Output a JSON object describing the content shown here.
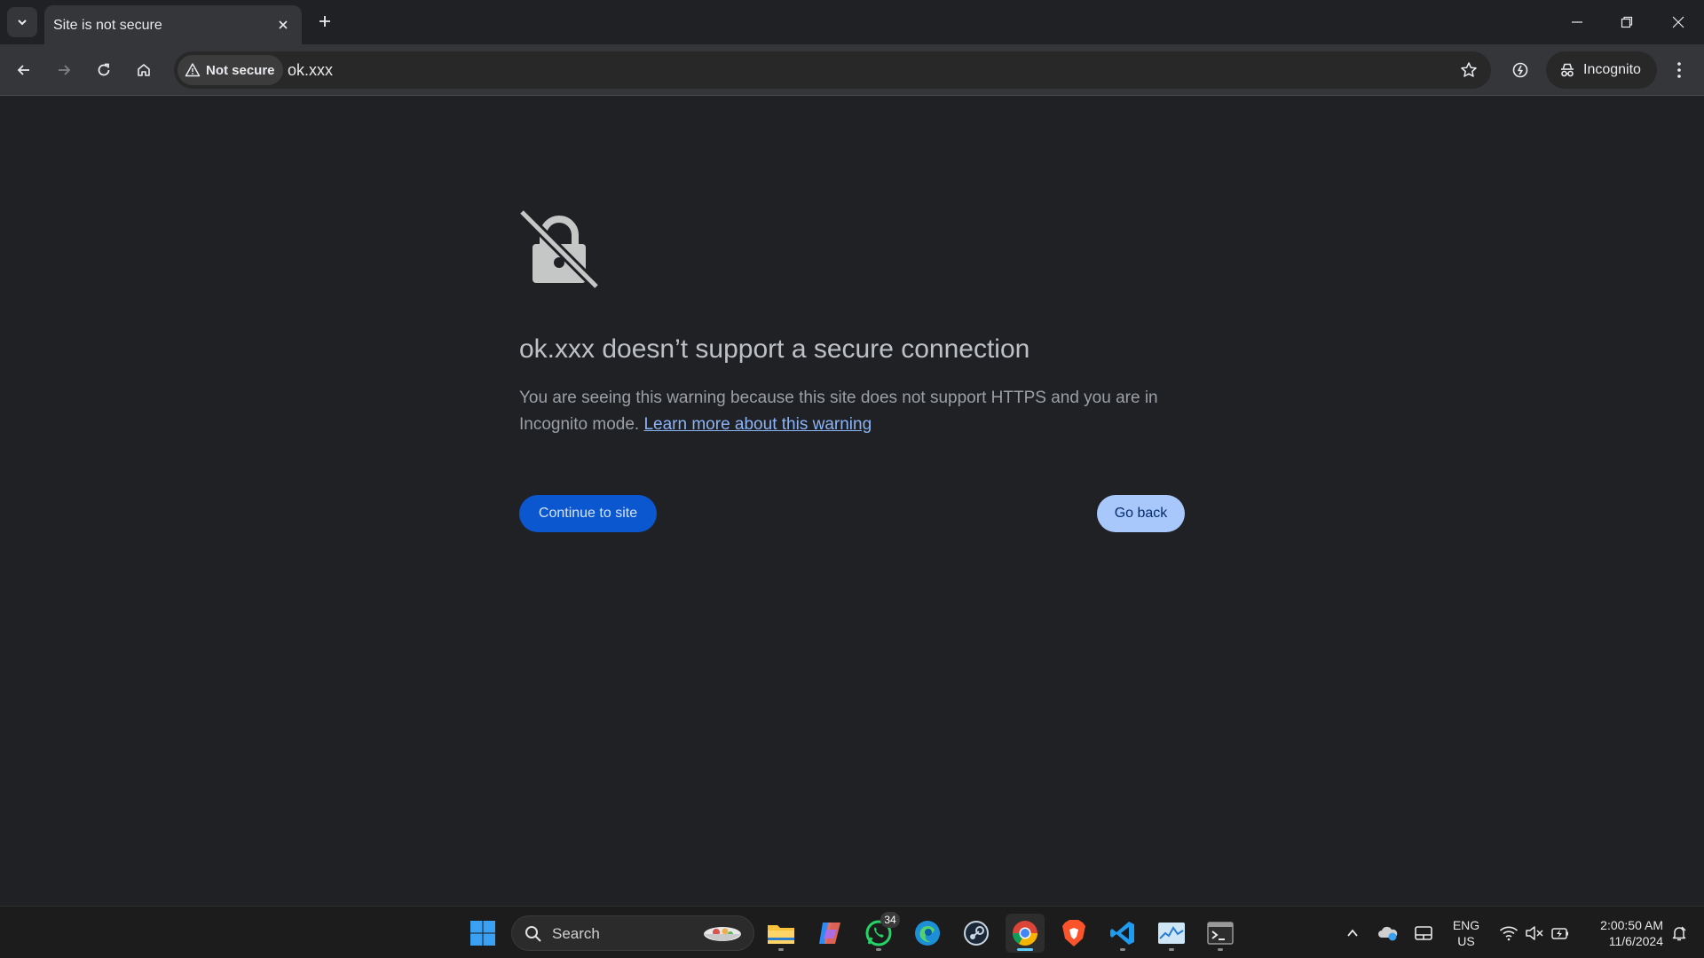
{
  "tab": {
    "title": "Site is not secure"
  },
  "omnibox": {
    "security_chip": "Not secure",
    "url": "ok.xxx"
  },
  "profile": {
    "label": "Incognito"
  },
  "interstitial": {
    "heading": "ok.xxx doesn’t support a secure connection",
    "body_text": "You are seeing this warning because this site does not support HTTPS and you are in Incognito mode.",
    "learn_more_link": "Learn more about this warning",
    "continue_button": "Continue to site",
    "back_button": "Go back"
  },
  "taskbar": {
    "search_label": "Search",
    "whatsapp_badge": "34",
    "apps": [
      "start-icon",
      "file-explorer-icon",
      "copilot-icon",
      "whatsapp-icon",
      "edge-icon",
      "steam-icon",
      "chrome-icon",
      "brave-icon",
      "vscode-icon",
      "task-manager-icon",
      "terminal-icon"
    ]
  },
  "tray": {
    "lang_line1": "ENG",
    "lang_line2": "US",
    "time": "2:00:50 AM",
    "date": "11/6/2024"
  }
}
